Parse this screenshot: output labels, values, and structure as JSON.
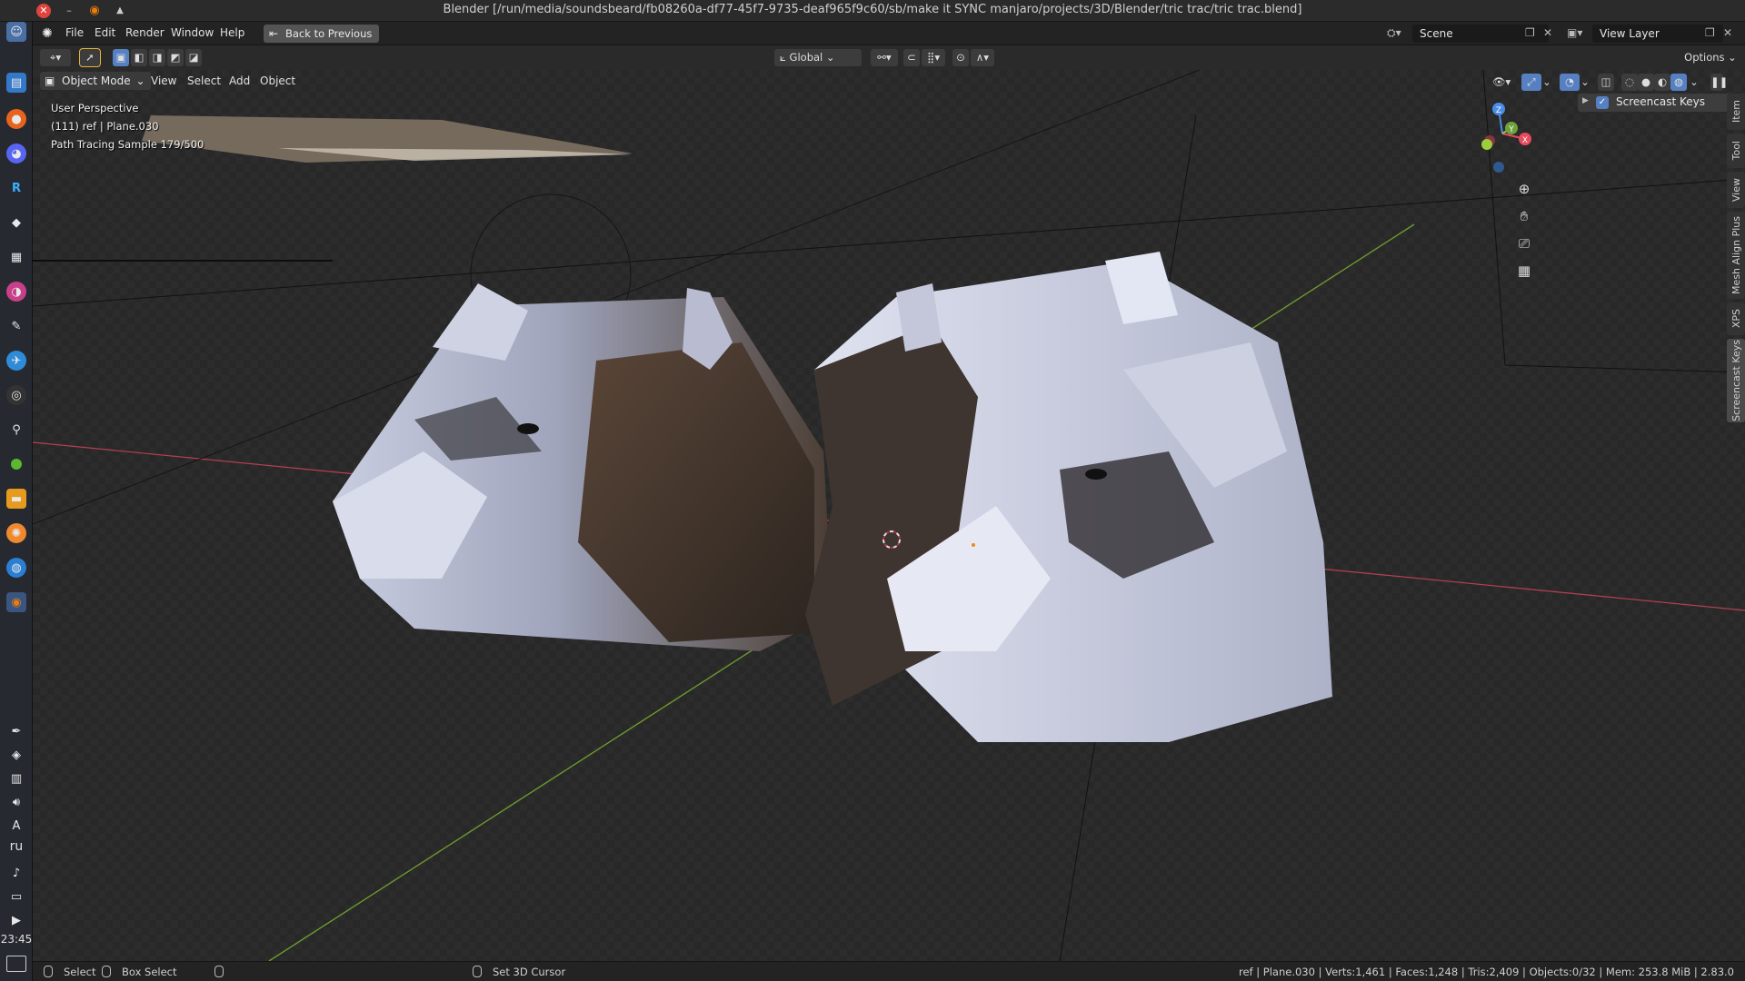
{
  "window": {
    "title": "Blender [/run/media/soundsbeard/fb08260a-df77-45f7-9735-deaf965f9c60/sb/make it SYNC manjaro/projects/3D/Blender/tric trac/tric trac.blend]"
  },
  "dock": {
    "lang": "ru",
    "clock": "23:45"
  },
  "menu": {
    "items": [
      "File",
      "Edit",
      "Render",
      "Window",
      "Help"
    ],
    "back_label": "Back to Previous",
    "scene_value": "Scene",
    "view_layer_value": "View Layer"
  },
  "toolheader": {
    "transform_orientation": "Global",
    "options_label": "Options"
  },
  "viewport": {
    "mode": "Object Mode",
    "menu_items": [
      "View",
      "Select",
      "Add",
      "Object"
    ],
    "overlay": {
      "perspective": "User Perspective",
      "object": "(111) ref | Plane.030",
      "sampling": "Path Tracing Sample 179/500"
    },
    "gizmo_axes": {
      "z": "Z",
      "y": "Y",
      "x": "X"
    }
  },
  "npanel": {
    "addon_label": "Screencast Keys",
    "tabs": [
      "Item",
      "Tool",
      "View",
      "Mesh Align Plus",
      "XPS",
      "Screencast Keys"
    ]
  },
  "statusbar": {
    "select": "Select",
    "box_select": "Box Select",
    "set_cursor": "Set 3D Cursor",
    "stats": "ref | Plane.030 | Verts:1,461 | Faces:1,248 | Tris:2,409 | Objects:0/32 | Mem: 253.8 MiB | 2.83.0"
  },
  "colors": {
    "accent": "#5680c2",
    "x_axis": "#e84a5f",
    "y_axis": "#8bc34a",
    "z_axis": "#4a8be8",
    "close": "#e0443e",
    "blender_orange": "#e87d0d"
  }
}
